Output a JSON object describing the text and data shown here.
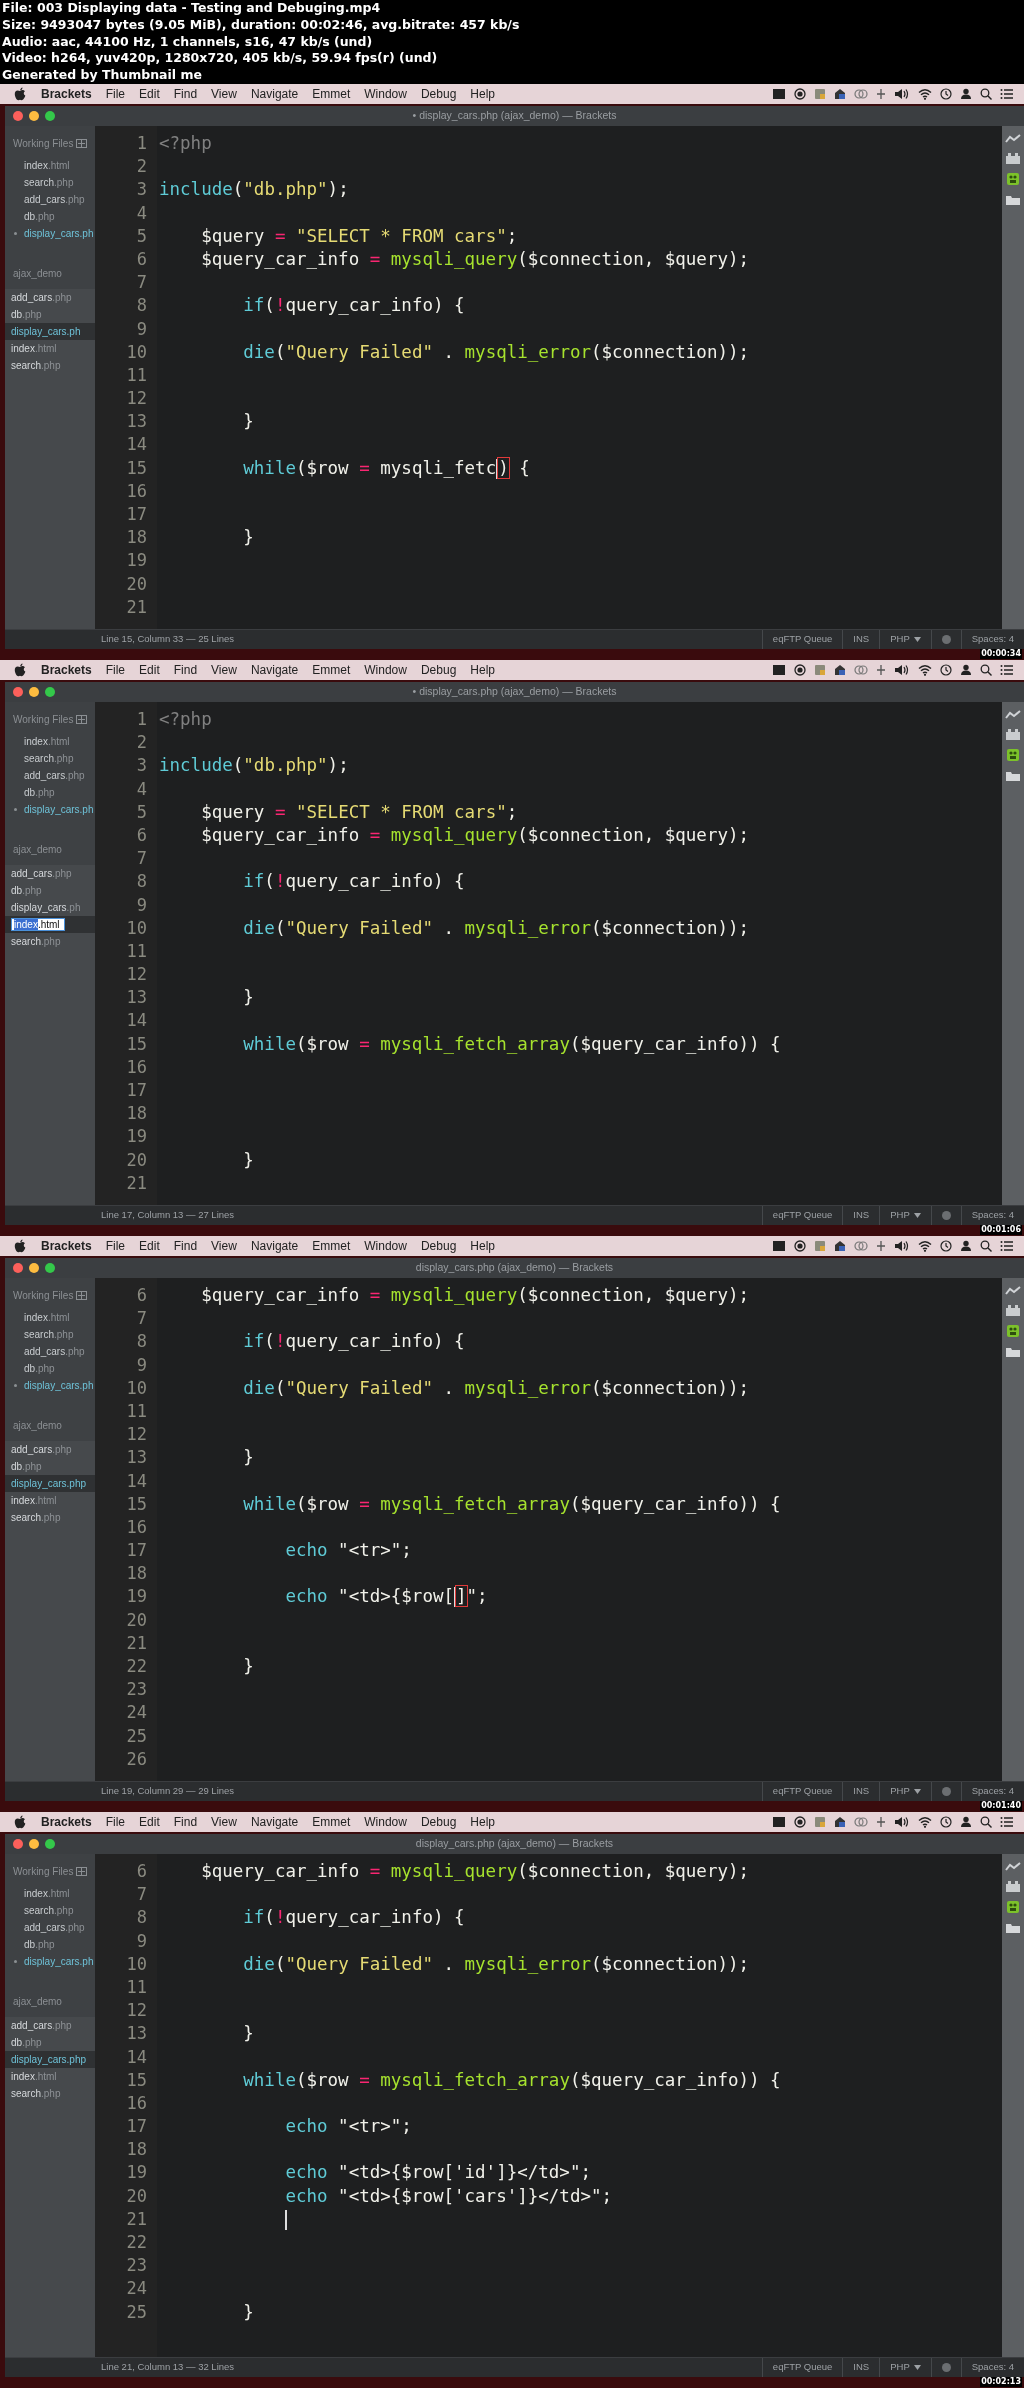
{
  "header": {
    "lines": [
      "File: 003 Displaying data - Testing and Debuging.mp4",
      "Size: 9493047 bytes (9.05 MiB), duration: 00:02:46, avg.bitrate: 457 kb/s",
      "Audio: aac, 44100 Hz, 1 channels, s16, 47 kb/s (und)",
      "Video: h264, yuv420p, 1280x720, 405 kb/s, 59.94 fps(r) (und)",
      "Generated by Thumbnail me"
    ]
  },
  "frames": [
    {
      "menu_bar": {
        "app": "Brackets",
        "items": [
          "File",
          "Edit",
          "Find",
          "View",
          "Navigate",
          "Emmet",
          "Window",
          "Debug",
          "Help"
        ]
      },
      "window_title": "• display_cars.php (ajax_demo) — Brackets",
      "sidebar": {
        "working_files_label": "Working Files",
        "working_files": [
          {
            "name": "index",
            "ext": ".html",
            "selected": false,
            "modified": false
          },
          {
            "name": "search",
            "ext": ".php",
            "selected": false,
            "modified": false
          },
          {
            "name": "add_cars",
            "ext": ".php",
            "selected": false,
            "modified": false
          },
          {
            "name": "db",
            "ext": ".php",
            "selected": false,
            "modified": false
          },
          {
            "name": "display_cars",
            "ext": ".ph",
            "selected": true,
            "modified": true
          }
        ],
        "project_label": "ajax_demo",
        "project_files": [
          {
            "name": "add_cars",
            "ext": ".php",
            "selected": false,
            "renaming": false
          },
          {
            "name": "db",
            "ext": ".php",
            "selected": false,
            "renaming": false
          },
          {
            "name": "display_cars",
            "ext": ".ph",
            "selected": true,
            "renaming": false
          },
          {
            "name": "index",
            "ext": ".html",
            "selected": false,
            "renaming": false
          },
          {
            "name": "search",
            "ext": ".php",
            "selected": false,
            "renaming": false
          }
        ]
      },
      "code_lines": [
        {
          "number": "1",
          "tokens": [
            {
              "kind": "tag",
              "text": "<?php"
            }
          ]
        },
        {
          "number": "2"
        },
        {
          "number": "3",
          "tokens": [
            {
              "kind": "keyword",
              "text": "include"
            },
            {
              "kind": "plain",
              "text": "("
            },
            {
              "kind": "string",
              "text": "\"db.php\""
            },
            {
              "kind": "plain",
              "text": ");"
            }
          ]
        },
        {
          "number": "4"
        },
        {
          "number": "5",
          "tokens": [
            {
              "kind": "plain",
              "text": "    $query "
            },
            {
              "kind": "operator",
              "text": "= "
            },
            {
              "kind": "string",
              "text": "\"SELECT * FROM cars\""
            },
            {
              "kind": "plain",
              "text": ";"
            }
          ]
        },
        {
          "number": "6",
          "tokens": [
            {
              "kind": "plain",
              "text": "    $query_car_info "
            },
            {
              "kind": "operator",
              "text": "= "
            },
            {
              "kind": "function",
              "text": "mysqli_query"
            },
            {
              "kind": "plain",
              "text": "($connection, $query);"
            }
          ]
        },
        {
          "number": "7"
        },
        {
          "number": "8",
          "tokens": [
            {
              "kind": "keyword",
              "text": "        if"
            },
            {
              "kind": "plain",
              "text": "("
            },
            {
              "kind": "operator",
              "text": "!"
            },
            {
              "kind": "plain",
              "text": "query_car_info) {"
            }
          ]
        },
        {
          "number": "9"
        },
        {
          "number": "10",
          "tokens": [
            {
              "kind": "keyword",
              "text": "        die"
            },
            {
              "kind": "plain",
              "text": "("
            },
            {
              "kind": "string",
              "text": "\"Query Failed\""
            },
            {
              "kind": "plain",
              "text": " . "
            },
            {
              "kind": "function",
              "text": "mysqli_error"
            },
            {
              "kind": "plain",
              "text": "($connection));"
            }
          ]
        },
        {
          "number": "11"
        },
        {
          "number": "12"
        },
        {
          "number": "13",
          "tokens": [
            {
              "kind": "plain",
              "text": "        }"
            }
          ]
        },
        {
          "number": "14"
        },
        {
          "number": "15",
          "tokens": [
            {
              "kind": "keyword",
              "text": "        while"
            },
            {
              "kind": "plain",
              "text": "($row "
            },
            {
              "kind": "operator",
              "text": "="
            },
            {
              "kind": "plain",
              "text": " mysqli_fetc"
            },
            {
              "kind": "cursor"
            },
            {
              "kind": "matched",
              "text": ")"
            },
            {
              "kind": "plain",
              "text": " {"
            }
          ]
        },
        {
          "number": "16"
        },
        {
          "number": "17"
        },
        {
          "number": "18",
          "tokens": [
            {
              "kind": "plain",
              "text": "        }"
            }
          ]
        },
        {
          "number": "19"
        },
        {
          "number": "20"
        },
        {
          "number": "21"
        }
      ],
      "status": {
        "position": "Line 15, Column 33 — 25 Lines",
        "queue": "eqFTP Queue",
        "mode": "INS",
        "language": "PHP",
        "spaces": "Spaces: 4"
      },
      "timestamp": "00:00:34"
    },
    {
      "menu_bar": {
        "app": "Brackets",
        "items": [
          "File",
          "Edit",
          "Find",
          "View",
          "Navigate",
          "Emmet",
          "Window",
          "Debug",
          "Help"
        ]
      },
      "window_title": "• display_cars.php (ajax_demo) — Brackets",
      "sidebar": {
        "working_files_label": "Working Files",
        "working_files": [
          {
            "name": "index",
            "ext": ".html",
            "selected": false,
            "modified": false
          },
          {
            "name": "search",
            "ext": ".php",
            "selected": false,
            "modified": false
          },
          {
            "name": "add_cars",
            "ext": ".php",
            "selected": false,
            "modified": false
          },
          {
            "name": "db",
            "ext": ".php",
            "selected": false,
            "modified": false
          },
          {
            "name": "display_cars",
            "ext": ".ph",
            "selected": true,
            "modified": true
          }
        ],
        "project_label": "ajax_demo",
        "project_files": [
          {
            "name": "add_cars",
            "ext": ".php",
            "selected": false,
            "renaming": false
          },
          {
            "name": "db",
            "ext": ".php",
            "selected": false,
            "renaming": false
          },
          {
            "name": "display_cars",
            "ext": ".ph",
            "selected": false,
            "renaming": false
          },
          {
            "name": "index",
            "ext": ".html",
            "selected": true,
            "renaming": true
          },
          {
            "name": "search",
            "ext": ".php",
            "selected": false,
            "renaming": false
          }
        ]
      },
      "code_lines": [
        {
          "number": "1",
          "tokens": [
            {
              "kind": "tag",
              "text": "<?php"
            }
          ]
        },
        {
          "number": "2"
        },
        {
          "number": "3",
          "tokens": [
            {
              "kind": "keyword",
              "text": "include"
            },
            {
              "kind": "plain",
              "text": "("
            },
            {
              "kind": "string",
              "text": "\"db.php\""
            },
            {
              "kind": "plain",
              "text": ");"
            }
          ]
        },
        {
          "number": "4"
        },
        {
          "number": "5",
          "tokens": [
            {
              "kind": "plain",
              "text": "    $query "
            },
            {
              "kind": "operator",
              "text": "= "
            },
            {
              "kind": "string",
              "text": "\"SELECT * FROM cars\""
            },
            {
              "kind": "plain",
              "text": ";"
            }
          ]
        },
        {
          "number": "6",
          "tokens": [
            {
              "kind": "plain",
              "text": "    $query_car_info "
            },
            {
              "kind": "operator",
              "text": "= "
            },
            {
              "kind": "function",
              "text": "mysqli_query"
            },
            {
              "kind": "plain",
              "text": "($connection, $query);"
            }
          ]
        },
        {
          "number": "7"
        },
        {
          "number": "8",
          "tokens": [
            {
              "kind": "keyword",
              "text": "        if"
            },
            {
              "kind": "plain",
              "text": "("
            },
            {
              "kind": "operator",
              "text": "!"
            },
            {
              "kind": "plain",
              "text": "query_car_info) {"
            }
          ]
        },
        {
          "number": "9"
        },
        {
          "number": "10",
          "tokens": [
            {
              "kind": "keyword",
              "text": "        die"
            },
            {
              "kind": "plain",
              "text": "("
            },
            {
              "kind": "string",
              "text": "\"Query Failed\""
            },
            {
              "kind": "plain",
              "text": " . "
            },
            {
              "kind": "function",
              "text": "mysqli_error"
            },
            {
              "kind": "plain",
              "text": "($connection));"
            }
          ]
        },
        {
          "number": "11"
        },
        {
          "number": "12"
        },
        {
          "number": "13",
          "tokens": [
            {
              "kind": "plain",
              "text": "        }"
            }
          ]
        },
        {
          "number": "14"
        },
        {
          "number": "15",
          "tokens": [
            {
              "kind": "keyword",
              "text": "        while"
            },
            {
              "kind": "plain",
              "text": "($row "
            },
            {
              "kind": "operator",
              "text": "= "
            },
            {
              "kind": "function",
              "text": "mysqli_fetch_array"
            },
            {
              "kind": "plain",
              "text": "($query_car_info)) {"
            }
          ]
        },
        {
          "number": "16"
        },
        {
          "number": "17"
        },
        {
          "number": "18"
        },
        {
          "number": "19"
        },
        {
          "number": "20",
          "tokens": [
            {
              "kind": "plain",
              "text": "        }"
            }
          ]
        },
        {
          "number": "21"
        }
      ],
      "status": {
        "position": "Line 17, Column 13 — 27 Lines",
        "queue": "eqFTP Queue",
        "mode": "INS",
        "language": "PHP",
        "spaces": "Spaces: 4"
      },
      "timestamp": "00:01:06"
    },
    {
      "menu_bar": {
        "app": "Brackets",
        "items": [
          "File",
          "Edit",
          "Find",
          "View",
          "Navigate",
          "Emmet",
          "Window",
          "Debug",
          "Help"
        ]
      },
      "window_title": "display_cars.php (ajax_demo) — Brackets",
      "sidebar": {
        "working_files_label": "Working Files",
        "working_files": [
          {
            "name": "index",
            "ext": ".html",
            "selected": false,
            "modified": false
          },
          {
            "name": "search",
            "ext": ".php",
            "selected": false,
            "modified": false
          },
          {
            "name": "add_cars",
            "ext": ".php",
            "selected": false,
            "modified": false
          },
          {
            "name": "db",
            "ext": ".php",
            "selected": false,
            "modified": false
          },
          {
            "name": "display_cars",
            "ext": ".ph",
            "selected": true,
            "modified": true
          }
        ],
        "project_label": "ajax_demo",
        "project_files": [
          {
            "name": "add_cars",
            "ext": ".php",
            "selected": false,
            "renaming": false
          },
          {
            "name": "db",
            "ext": ".php",
            "selected": false,
            "renaming": false
          },
          {
            "name": "display_cars",
            "ext": ".php",
            "selected": true,
            "renaming": false
          },
          {
            "name": "index",
            "ext": ".html",
            "selected": false,
            "renaming": false
          },
          {
            "name": "search",
            "ext": ".php",
            "selected": false,
            "renaming": false
          }
        ]
      },
      "code_lines": [
        {
          "number": "6",
          "tokens": [
            {
              "kind": "plain",
              "text": "    $query_car_info "
            },
            {
              "kind": "operator",
              "text": "= "
            },
            {
              "kind": "function",
              "text": "mysqli_query"
            },
            {
              "kind": "plain",
              "text": "($connection, $query);"
            }
          ]
        },
        {
          "number": "7"
        },
        {
          "number": "8",
          "tokens": [
            {
              "kind": "keyword",
              "text": "        if"
            },
            {
              "kind": "plain",
              "text": "("
            },
            {
              "kind": "operator",
              "text": "!"
            },
            {
              "kind": "plain",
              "text": "query_car_info) {"
            }
          ]
        },
        {
          "number": "9"
        },
        {
          "number": "10",
          "tokens": [
            {
              "kind": "keyword",
              "text": "        die"
            },
            {
              "kind": "plain",
              "text": "("
            },
            {
              "kind": "string",
              "text": "\"Query Failed\""
            },
            {
              "kind": "plain",
              "text": " . "
            },
            {
              "kind": "function",
              "text": "mysqli_error"
            },
            {
              "kind": "plain",
              "text": "($connection));"
            }
          ]
        },
        {
          "number": "11"
        },
        {
          "number": "12"
        },
        {
          "number": "13",
          "tokens": [
            {
              "kind": "plain",
              "text": "        }"
            }
          ]
        },
        {
          "number": "14"
        },
        {
          "number": "15",
          "tokens": [
            {
              "kind": "keyword",
              "text": "        while"
            },
            {
              "kind": "plain",
              "text": "($row "
            },
            {
              "kind": "operator",
              "text": "= "
            },
            {
              "kind": "function",
              "text": "mysqli_fetch_array"
            },
            {
              "kind": "plain",
              "text": "($query_car_info)) {"
            }
          ]
        },
        {
          "number": "16"
        },
        {
          "number": "17",
          "tokens": [
            {
              "kind": "keyword",
              "text": "            echo"
            },
            {
              "kind": "plain",
              "text": " \"<tr>\";"
            }
          ]
        },
        {
          "number": "18"
        },
        {
          "number": "19",
          "tokens": [
            {
              "kind": "keyword",
              "text": "            echo"
            },
            {
              "kind": "plain",
              "text": " \"<td>{$row["
            },
            {
              "kind": "cursor"
            },
            {
              "kind": "matched",
              "text": "]"
            },
            {
              "kind": "plain",
              "text": "\";"
            }
          ]
        },
        {
          "number": "20"
        },
        {
          "number": "21"
        },
        {
          "number": "22",
          "tokens": [
            {
              "kind": "plain",
              "text": "        }"
            }
          ]
        },
        {
          "number": "23"
        },
        {
          "number": "24"
        },
        {
          "number": "25"
        },
        {
          "number": "26"
        }
      ],
      "status": {
        "position": "Line 19, Column 29 — 29 Lines",
        "queue": "eqFTP Queue",
        "mode": "INS",
        "language": "PHP",
        "spaces": "Spaces: 4"
      },
      "timestamp": "00:01:40"
    },
    {
      "menu_bar": {
        "app": "Brackets",
        "items": [
          "File",
          "Edit",
          "Find",
          "View",
          "Navigate",
          "Emmet",
          "Window",
          "Debug",
          "Help"
        ]
      },
      "window_title": "display_cars.php (ajax_demo) — Brackets",
      "sidebar": {
        "working_files_label": "Working Files",
        "working_files": [
          {
            "name": "index",
            "ext": ".html",
            "selected": false,
            "modified": false
          },
          {
            "name": "search",
            "ext": ".php",
            "selected": false,
            "modified": false
          },
          {
            "name": "add_cars",
            "ext": ".php",
            "selected": false,
            "modified": false
          },
          {
            "name": "db",
            "ext": ".php",
            "selected": false,
            "modified": false
          },
          {
            "name": "display_cars",
            "ext": ".ph",
            "selected": true,
            "modified": true
          }
        ],
        "project_label": "ajax_demo",
        "project_files": [
          {
            "name": "add_cars",
            "ext": ".php",
            "selected": false,
            "renaming": false
          },
          {
            "name": "db",
            "ext": ".php",
            "selected": false,
            "renaming": false
          },
          {
            "name": "display_cars",
            "ext": ".php",
            "selected": true,
            "renaming": false
          },
          {
            "name": "index",
            "ext": ".html",
            "selected": false,
            "renaming": false
          },
          {
            "name": "search",
            "ext": ".php",
            "selected": false,
            "renaming": false
          }
        ]
      },
      "code_lines": [
        {
          "number": "6",
          "tokens": [
            {
              "kind": "plain",
              "text": "    $query_car_info "
            },
            {
              "kind": "operator",
              "text": "= "
            },
            {
              "kind": "function",
              "text": "mysqli_query"
            },
            {
              "kind": "plain",
              "text": "($connection, $query);"
            }
          ]
        },
        {
          "number": "7"
        },
        {
          "number": "8",
          "tokens": [
            {
              "kind": "keyword",
              "text": "        if"
            },
            {
              "kind": "plain",
              "text": "("
            },
            {
              "kind": "operator",
              "text": "!"
            },
            {
              "kind": "plain",
              "text": "query_car_info) {"
            }
          ]
        },
        {
          "number": "9"
        },
        {
          "number": "10",
          "tokens": [
            {
              "kind": "keyword",
              "text": "        die"
            },
            {
              "kind": "plain",
              "text": "("
            },
            {
              "kind": "string",
              "text": "\"Query Failed\""
            },
            {
              "kind": "plain",
              "text": " . "
            },
            {
              "kind": "function",
              "text": "mysqli_error"
            },
            {
              "kind": "plain",
              "text": "($connection));"
            }
          ]
        },
        {
          "number": "11"
        },
        {
          "number": "12"
        },
        {
          "number": "13",
          "tokens": [
            {
              "kind": "plain",
              "text": "        }"
            }
          ]
        },
        {
          "number": "14"
        },
        {
          "number": "15",
          "tokens": [
            {
              "kind": "keyword",
              "text": "        while"
            },
            {
              "kind": "plain",
              "text": "($row "
            },
            {
              "kind": "operator",
              "text": "= "
            },
            {
              "kind": "function",
              "text": "mysqli_fetch_array"
            },
            {
              "kind": "plain",
              "text": "($query_car_info)) {"
            }
          ]
        },
        {
          "number": "16"
        },
        {
          "number": "17",
          "tokens": [
            {
              "kind": "keyword",
              "text": "            echo"
            },
            {
              "kind": "plain",
              "text": " \"<tr>\";"
            }
          ]
        },
        {
          "number": "18"
        },
        {
          "number": "19",
          "tokens": [
            {
              "kind": "keyword",
              "text": "            echo"
            },
            {
              "kind": "plain",
              "text": " \"<td>{$row['id']}</td>\";"
            }
          ]
        },
        {
          "number": "20",
          "tokens": [
            {
              "kind": "keyword",
              "text": "            echo"
            },
            {
              "kind": "plain",
              "text": " \"<td>{$row['cars']}</td>\";"
            }
          ]
        },
        {
          "number": "21",
          "tokens": [
            {
              "kind": "cursor"
            }
          ]
        },
        {
          "number": "22"
        },
        {
          "number": "23"
        },
        {
          "number": "24"
        },
        {
          "number": "25",
          "tokens": [
            {
              "kind": "plain",
              "text": "        }"
            }
          ]
        }
      ],
      "status": {
        "position": "Line 21, Column 13 — 32 Lines",
        "queue": "eqFTP Queue",
        "mode": "INS",
        "language": "PHP",
        "spaces": "Spaces: 4"
      },
      "timestamp": "00:02:13"
    }
  ]
}
